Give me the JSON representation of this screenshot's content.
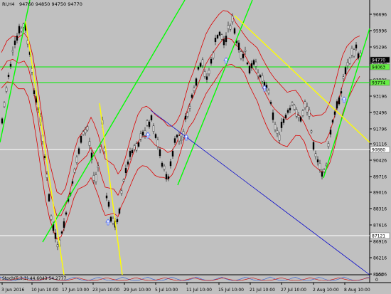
{
  "header": {
    "symbol_tf": "RI,H4",
    "ohlc": "94760 94850 94750 94770"
  },
  "indicator": {
    "label": "Stoch(5,3,3) 44.6043 54.2777"
  },
  "price_axis": {
    "ticks": [
      "96696",
      "95996",
      "95296",
      "94596",
      "93896",
      "93196",
      "92496",
      "91796",
      "91116",
      "90426",
      "89716",
      "89016",
      "88316",
      "87616",
      "86916",
      "86216",
      "85536"
    ],
    "badges": [
      {
        "text": "94770",
        "bg": "#000000",
        "fg": "#ffffff"
      },
      {
        "text": "94063",
        "bg": "#66ee44",
        "fg": "#000000"
      },
      {
        "text": "93774",
        "bg": "#66ee44",
        "fg": "#000000"
      },
      {
        "text": "90880",
        "bg": "#ffffff",
        "fg": "#000000"
      },
      {
        "text": "87121",
        "bg": "#ffffff",
        "fg": "#000000"
      }
    ],
    "indicator_ticks": [
      "100",
      "0"
    ]
  },
  "time_axis": {
    "ticks": [
      "3 Jun 2016",
      "10 Jun 10:00",
      "17 Jun 10:00",
      "23 Jun 10:00",
      "29 Jun 10:00",
      "5 Jul 10:00",
      "11 Jul 10:00",
      "15 Jul 10:00",
      "21 Jul 10:00",
      "27 Jul 10:00",
      "2 Aug 10:00",
      "8 Aug 10:00"
    ]
  },
  "colors": {
    "background": "#c0c0c0",
    "bollinger": "#dd0000",
    "trend_green": "#00ff00",
    "trend_yellow": "#ffff00",
    "trend_blue": "#0000cc",
    "hline_green": "#00ee00",
    "hline_white": "#ffffff",
    "candle": "#000000",
    "arrow": "#4466ff"
  },
  "chart_data": {
    "type": "candlestick",
    "title": "RI,H4",
    "x": [
      "3 Jun 2016",
      "10 Jun 10:00",
      "17 Jun 10:00",
      "23 Jun 10:00",
      "29 Jun 10:00",
      "5 Jul 10:00",
      "11 Jul 10:00",
      "15 Jul 10:00",
      "21 Jul 10:00",
      "27 Jul 10:00",
      "2 Aug 10:00",
      "8 Aug 10:00"
    ],
    "approx_close": [
      94500,
      89000,
      88500,
      87500,
      91500,
      90300,
      94300,
      95500,
      92200,
      91100,
      90000,
      94770
    ],
    "ylim": [
      85536,
      97000
    ],
    "horizontal_levels": [
      94063,
      93774,
      90880,
      87121
    ],
    "last_price": 94770,
    "lower_panel": {
      "name": "Stoch(5,3,3)",
      "values": [
        44.6043,
        54.2777
      ],
      "ylim": [
        0,
        100
      ]
    }
  }
}
